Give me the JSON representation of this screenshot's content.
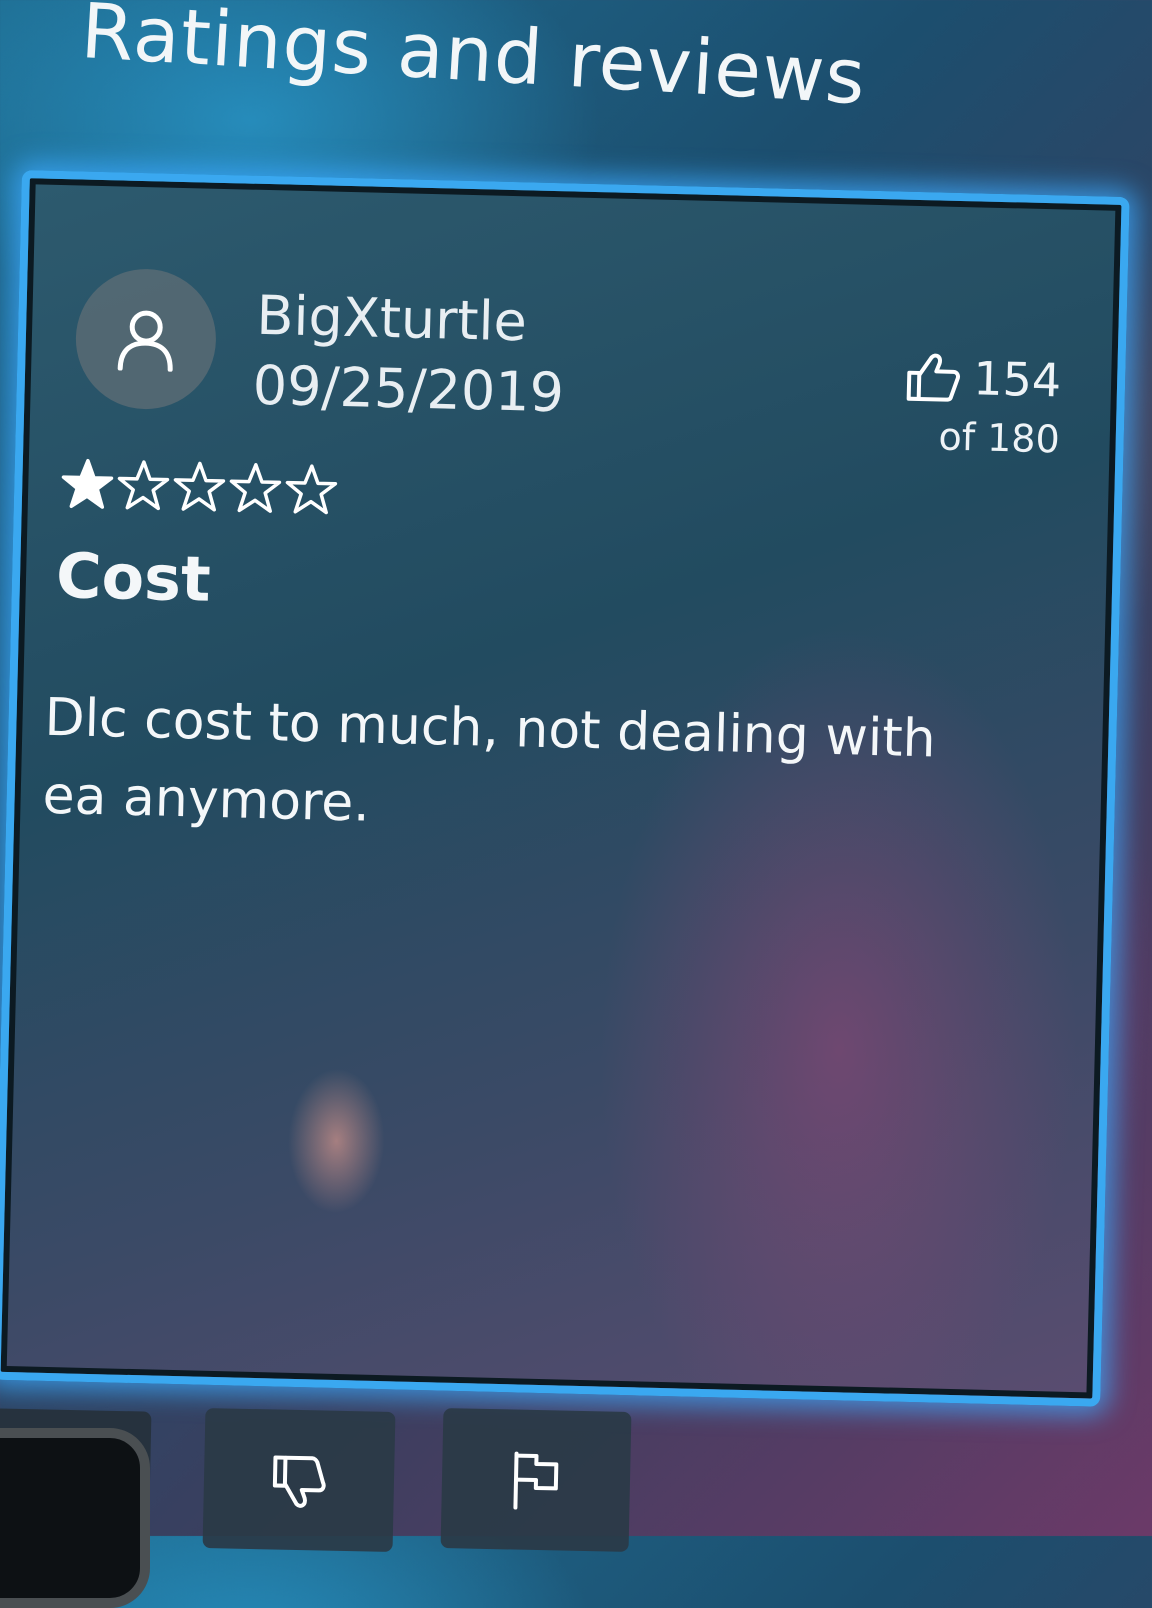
{
  "page": {
    "title": "Ratings and reviews"
  },
  "review": {
    "user_name": "BigXturtle",
    "date": "09/25/2019",
    "helpful_count": "154",
    "helpful_total": "of 180",
    "rating": 1,
    "rating_max": 5,
    "title": "Cost",
    "body": "Dlc cost to much, not dealing with ea anymore."
  },
  "actions": [
    {
      "name": "thumbs-up",
      "icon": "thumbs-up-icon"
    },
    {
      "name": "thumbs-down",
      "icon": "thumbs-down-icon"
    },
    {
      "name": "report",
      "icon": "flag-icon"
    }
  ],
  "colors": {
    "accent": "#3aa8f0",
    "text": "#ffffff"
  }
}
